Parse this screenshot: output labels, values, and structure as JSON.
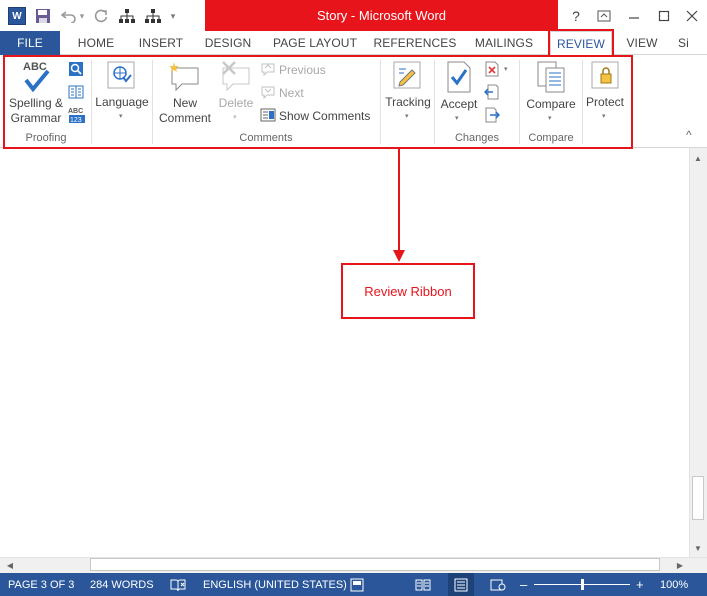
{
  "window": {
    "title": "Story -  Microsoft Word",
    "help": "?",
    "ribbon_display": "⊡",
    "minimize": "—",
    "restore": "❐",
    "close": "✕"
  },
  "qat": {
    "word_icon_letter": "W",
    "save_icon": "save-icon",
    "undo_icon": "undo-icon",
    "undo_dropdown": "▾",
    "redo_icon": "redo-icon",
    "org1_icon": "org-chart-icon",
    "org2_icon": "org-chart-icon",
    "customize": "▾"
  },
  "tabs": [
    {
      "label": "FILE"
    },
    {
      "label": "HOME"
    },
    {
      "label": "INSERT"
    },
    {
      "label": "DESIGN"
    },
    {
      "label": "PAGE LAYOUT"
    },
    {
      "label": "REFERENCES"
    },
    {
      "label": "MAILINGS"
    },
    {
      "label": "REVIEW"
    },
    {
      "label": "VIEW"
    },
    {
      "label": "Si"
    }
  ],
  "ribbon": {
    "proofing": {
      "abc": "ABC",
      "spelling_line1": "Spelling &",
      "spelling_line2": "Grammar",
      "label": "Proofing",
      "abc_small": "ABC",
      "num_small": "123"
    },
    "language": {
      "label": "Language",
      "dropdown": "▾"
    },
    "comments": {
      "new_line1": "New",
      "new_line2": "Comment",
      "delete": "Delete",
      "previous": "Previous",
      "next": "Next",
      "show": "Show Comments",
      "label": "Comments"
    },
    "tracking": {
      "label": "Tracking",
      "dropdown": "▾"
    },
    "changes": {
      "accept": "Accept",
      "label": "Changes",
      "dropdown": "▾"
    },
    "compare": {
      "button": "Compare",
      "label": "Compare",
      "dropdown": "▾"
    },
    "protect": {
      "button": "Protect",
      "dropdown": "▾"
    },
    "collapse": "^"
  },
  "callout": {
    "text": "Review Ribbon"
  },
  "status": {
    "page": "PAGE 3 OF 3",
    "words": "284 WORDS",
    "language": "ENGLISH (UNITED STATES)",
    "zoom_minus": "–",
    "zoom_plus": "+",
    "zoom": "100%"
  },
  "colors": {
    "accent": "#2b579a",
    "highlight": "#e8141c"
  }
}
